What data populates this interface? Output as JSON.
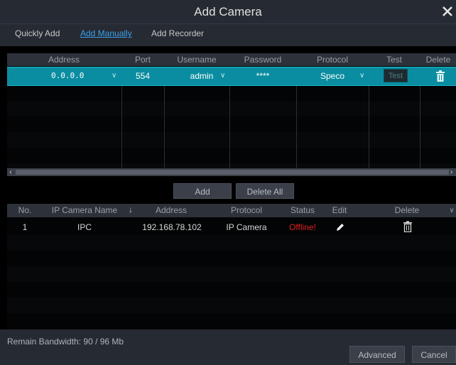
{
  "dialog": {
    "title": "Add Camera"
  },
  "tabs": [
    {
      "label": "Quickly Add"
    },
    {
      "label": "Add Manually"
    },
    {
      "label": "Add Recorder"
    }
  ],
  "add_table": {
    "headers": [
      "Address",
      "Port",
      "Username",
      "Password",
      "Protocol",
      "Test",
      "Delete"
    ],
    "row": {
      "address": "0.0.0.0",
      "port": "554",
      "username": "admin",
      "password": "****",
      "protocol": "Speco",
      "test_label": "Test"
    }
  },
  "buttons": {
    "add": "Add",
    "delete_all": "Delete All",
    "advanced": "Advanced",
    "cancel": "Cancel"
  },
  "camera_table": {
    "headers": [
      "No.",
      "IP Camera Name",
      "Address",
      "Protocol",
      "Status",
      "Edit",
      "Delete"
    ],
    "rows": [
      {
        "no": "1",
        "name": "IPC",
        "address": "192.168.78.102",
        "protocol": "IP Camera",
        "status": "Offline!"
      }
    ]
  },
  "footer": {
    "bandwidth": "Remain Bandwidth: 90 / 96 Mb"
  },
  "colors": {
    "accent": "#3aa0e8",
    "selected_row": "#0a8da0",
    "offline": "#e02020"
  }
}
